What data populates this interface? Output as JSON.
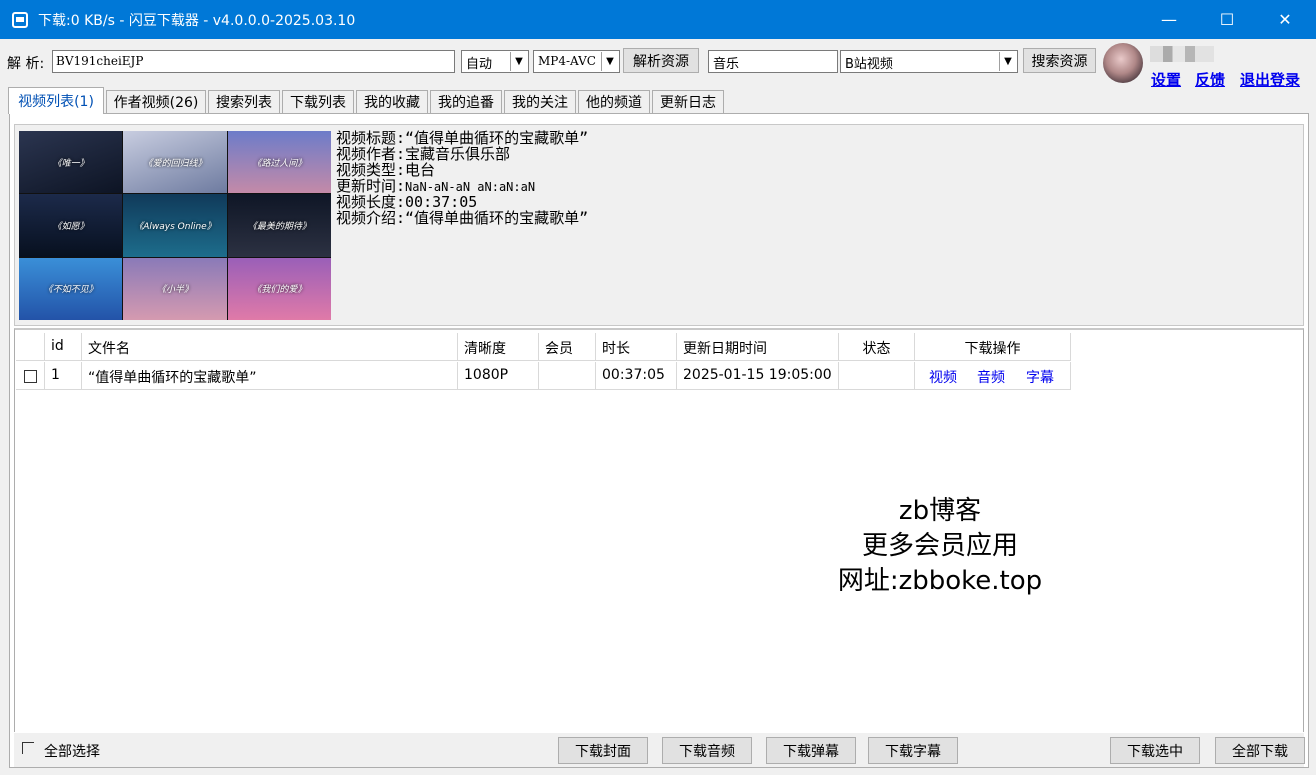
{
  "window": {
    "title": "下载:0 KB/s - 闪豆下载器 - v4.0.0.0-2025.03.10",
    "min_glyph": "—",
    "max_glyph": "☐",
    "close_glyph": "✕"
  },
  "toolbar": {
    "parse_label": "解 析:",
    "url_value": "BV191cheiEJP",
    "quality_value": "自动",
    "format_value": "MP4-AVC",
    "parse_button": "解析资源",
    "search_value": "音乐",
    "source_value": "B站视频",
    "search_button": "搜索资源",
    "dropdown_glyph": "▼"
  },
  "user": {
    "settings": "设置",
    "feedback": "反馈",
    "logout": "退出登录"
  },
  "tabs": [
    {
      "label": "视频列表(1)"
    },
    {
      "label": "作者视频(26)"
    },
    {
      "label": "搜索列表"
    },
    {
      "label": "下载列表"
    },
    {
      "label": "我的收藏"
    },
    {
      "label": "我的追番"
    },
    {
      "label": "我的关注"
    },
    {
      "label": "他的频道"
    },
    {
      "label": "更新日志"
    }
  ],
  "thumbnail": {
    "tiles": [
      "《唯一》",
      "《爱的回归线》",
      "《路过人间》",
      "《如愿》",
      "《Always Online》",
      "《最美的期待》",
      "《不如不见》",
      "《小半》",
      "《我们的爱》"
    ]
  },
  "video_info": {
    "title_line": "视频标题:“值得单曲循环的宝藏歌单”",
    "author_line": "视频作者:宝藏音乐俱乐部",
    "type_line": "视频类型:电台",
    "updated_label": "更新时间:",
    "updated_value": "NaN-aN-aN aN:aN:aN",
    "duration_line": "视频长度:00:37:05",
    "intro_line": "视频介绍:“值得单曲循环的宝藏歌单”"
  },
  "table": {
    "headers": [
      "id",
      "文件名",
      "清晰度",
      "会员",
      "时长",
      "更新日期时间",
      "状态",
      "下载操作"
    ],
    "rows": [
      {
        "id": "1",
        "filename": "“值得单曲循环的宝藏歌单”",
        "quality": "1080P",
        "vip": "",
        "duration": "00:37:05",
        "updated": "2025-01-15 19:05:00",
        "status": "",
        "ops": [
          "视频",
          "音频",
          "字幕"
        ]
      }
    ]
  },
  "watermark": {
    "line1": "zb博客",
    "line2": "更多会员应用",
    "line3": "网址:zbboke.top"
  },
  "bottom": {
    "select_all": "全部选择",
    "download_cover": "下载封面",
    "download_audio": "下载音频",
    "download_danmaku": "下载弹幕",
    "download_subtitle": "下载字幕",
    "download_selected": "下载选中",
    "download_all": "全部下载"
  }
}
